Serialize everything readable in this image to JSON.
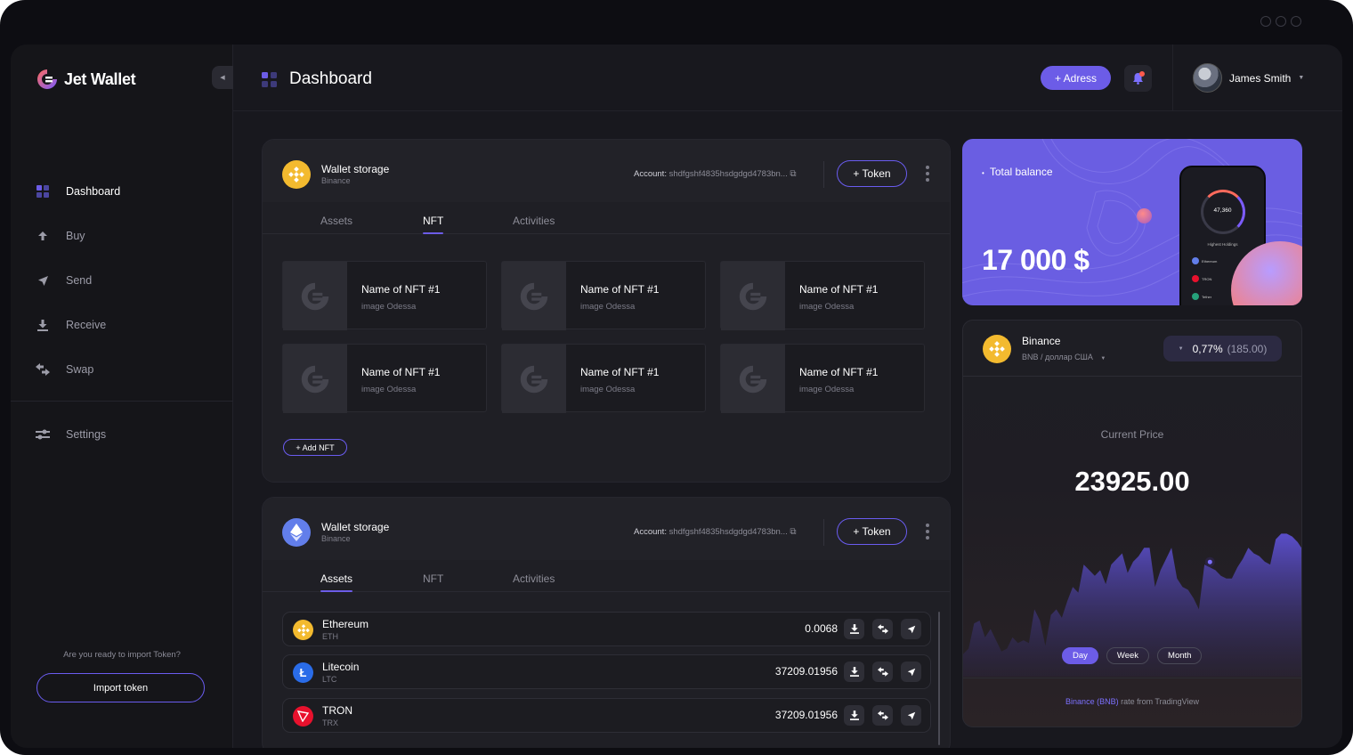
{
  "app": {
    "name": "Jet Wallet"
  },
  "sidebar": {
    "items": [
      {
        "label": "Dashboard",
        "icon": "dashboard-icon"
      },
      {
        "label": "Buy",
        "icon": "arrow-up-icon"
      },
      {
        "label": "Send",
        "icon": "send-icon"
      },
      {
        "label": "Receive",
        "icon": "download-icon"
      },
      {
        "label": "Swap",
        "icon": "swap-icon"
      }
    ],
    "settings_label": "Settings",
    "import_question": "Are you ready to import Token?",
    "import_button": "Import token"
  },
  "header": {
    "title": "Dashboard",
    "adress_button": "+ Adress",
    "user_name": "James Smith"
  },
  "wallet1": {
    "title": "Wallet storage",
    "subtitle": "Binance",
    "account_label": "Account:",
    "account_value": "shdfgshf4835hsdgdgd4783bn...",
    "token_button": "+ Token",
    "tabs": [
      "Assets",
      "NFT",
      "Activities"
    ],
    "active_tab": "NFT",
    "nfts": [
      {
        "name": "Name of NFT #1",
        "sub": "image Odessa"
      },
      {
        "name": "Name of NFT #1",
        "sub": "image Odessa"
      },
      {
        "name": "Name of NFT #1",
        "sub": "image Odessa"
      },
      {
        "name": "Name of NFT #1",
        "sub": "image Odessa"
      },
      {
        "name": "Name of NFT #1",
        "sub": "image Odessa"
      },
      {
        "name": "Name of NFT #1",
        "sub": "image Odessa"
      }
    ],
    "add_nft": "+ Add NFT"
  },
  "wallet2": {
    "title": "Wallet storage",
    "subtitle": "Binance",
    "account_label": "Account:",
    "account_value": "shdfgshf4835hsdgdgd4783bn...",
    "token_button": "+ Token",
    "tabs": [
      "Assets",
      "NFT",
      "Activities"
    ],
    "active_tab": "Assets",
    "assets": [
      {
        "name": "Ethereum",
        "symbol": "ETH",
        "value": "0.0068",
        "color": "#f3ba2f"
      },
      {
        "name": "Litecoin",
        "symbol": "LTC",
        "value": "37209.01956",
        "color": "#2a6ce8"
      },
      {
        "name": "TRON",
        "symbol": "TRX",
        "value": "37209.01956",
        "color": "#e8112d"
      }
    ]
  },
  "balance": {
    "label": "Total balance",
    "value": "17 000 $",
    "phone_amount": "47,360",
    "phone_caption": "Highest Holdings",
    "phone_items": [
      "Ethereum",
      "TRON",
      "Tether"
    ]
  },
  "binance": {
    "name": "Binance",
    "sub": "BNB / доллар США",
    "change": "0,77%",
    "change_abs": "(185.00)",
    "current_price_label": "Current Price",
    "current_price": "23925.00",
    "periods": [
      "Day",
      "Week",
      "Month"
    ],
    "active_period": "Day",
    "rate_highlight": "Binance (BNB)",
    "rate_text": " rate from TradingView",
    "chart_values": [
      40,
      50,
      95,
      100,
      70,
      85,
      65,
      45,
      50,
      70,
      60,
      65,
      60,
      120,
      100,
      55,
      110,
      120,
      105,
      135,
      160,
      150,
      200,
      190,
      180,
      190,
      165,
      200,
      210,
      220,
      185,
      205,
      215,
      230,
      230,
      160,
      190,
      210,
      230,
      175,
      160,
      155,
      140,
      120,
      200,
      195,
      190,
      180,
      175,
      175,
      195,
      210,
      230,
      220,
      215,
      205,
      200,
      245,
      255,
      255,
      250,
      240,
      225
    ]
  },
  "colors": {
    "accent": "#6c5ce7",
    "binance": "#f3ba2f",
    "ethereum": "#627eea"
  }
}
